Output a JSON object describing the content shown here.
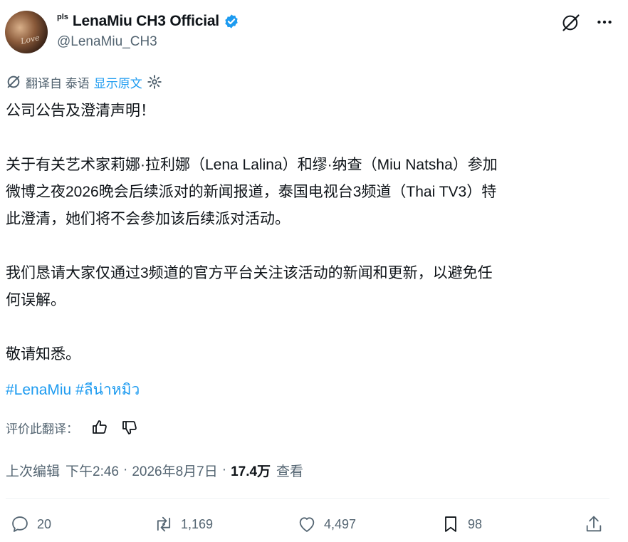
{
  "header": {
    "avatar_caption": "Love",
    "badge": "pls",
    "display_name": "LenaMiu CH3 Official",
    "handle": "@LenaMiu_CH3",
    "verified": true
  },
  "translation": {
    "label": "翻译自 泰语",
    "show_original": "显示原文"
  },
  "body": {
    "p1": "公司公告及澄清声明！",
    "p2_l1": "关于有关艺术家莉娜·拉利娜（Lena Lalina）和缪·纳查（Miu Natsha）参加",
    "p2_l2": "微博之夜2026晚会后续派对的新闻报道，泰国电视台3频道（Thai TV3）特",
    "p2_l3": "此澄清，她们将不会参加该后续派对活动。",
    "p3_l1": "我们恳请大家仅通过3频道的官方平台关注该活动的新闻和更新，以避免任",
    "p3_l2": "何误解。",
    "p4": "敬请知悉。",
    "hashtag1": "#LenaMiu",
    "hashtag2": "#ลีน่าหมิว"
  },
  "rate": {
    "label": "评价此翻译："
  },
  "meta": {
    "edited": "上次编辑",
    "time": "下午2:46",
    "sep1": "·",
    "date": "2026年8月7日",
    "sep2": "·",
    "views": "17.4万",
    "views_label": "查看"
  },
  "actions": {
    "replies": "20",
    "reposts": "1,169",
    "likes": "4,497",
    "bookmarks": "98"
  },
  "colors": {
    "accent": "#1d9bf0",
    "text": "#0f1419",
    "muted": "#536471"
  }
}
